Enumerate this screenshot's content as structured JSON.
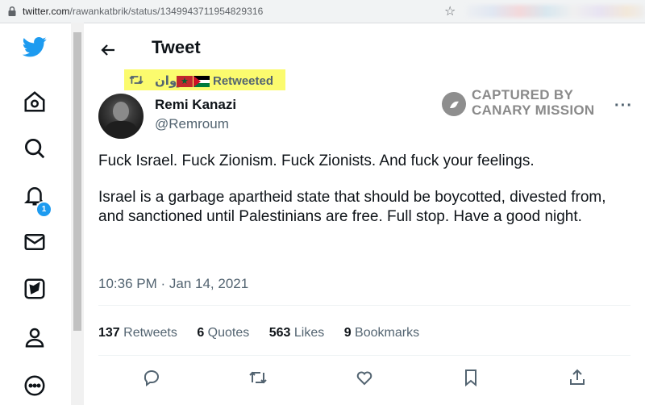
{
  "browser": {
    "url_host": "twitter.com",
    "url_path": "/rawankatbrik/status/1349943711954829316"
  },
  "nav": {
    "items": [
      "twitter-logo",
      "home",
      "explore",
      "notifications",
      "messages",
      "bookmarks",
      "profile",
      "more"
    ],
    "notifications_badge": "1"
  },
  "header": {
    "title": "Tweet"
  },
  "retweet": {
    "name": "روان",
    "label": "Retweeted"
  },
  "author": {
    "display_name": "Remi Kanazi",
    "handle": "@Remroum"
  },
  "watermark": {
    "line1": "CAPTURED BY",
    "line2": "CANARY MISSION"
  },
  "tweet": {
    "paragraphs": [
      "Fuck Israel. Fuck Zionism. Fuck Zionists. And fuck your feelings.",
      "Israel is a garbage apartheid state that should be boycotted, divested from, and sanctioned until Palestinians are free. Full stop. Have a good night."
    ],
    "timestamp": "10:36 PM · Jan 14, 2021"
  },
  "stats": {
    "retweets_count": "137",
    "retweets_label": "Retweets",
    "quotes_count": "6",
    "quotes_label": "Quotes",
    "likes_count": "563",
    "likes_label": "Likes",
    "bookmarks_count": "9",
    "bookmarks_label": "Bookmarks"
  },
  "actions": [
    "reply",
    "retweet",
    "like",
    "bookmark",
    "share"
  ],
  "colors": {
    "brand": "#1d9bf0",
    "highlight": "#fbfb6e",
    "text": "#0f1419",
    "secondary": "#536471"
  }
}
